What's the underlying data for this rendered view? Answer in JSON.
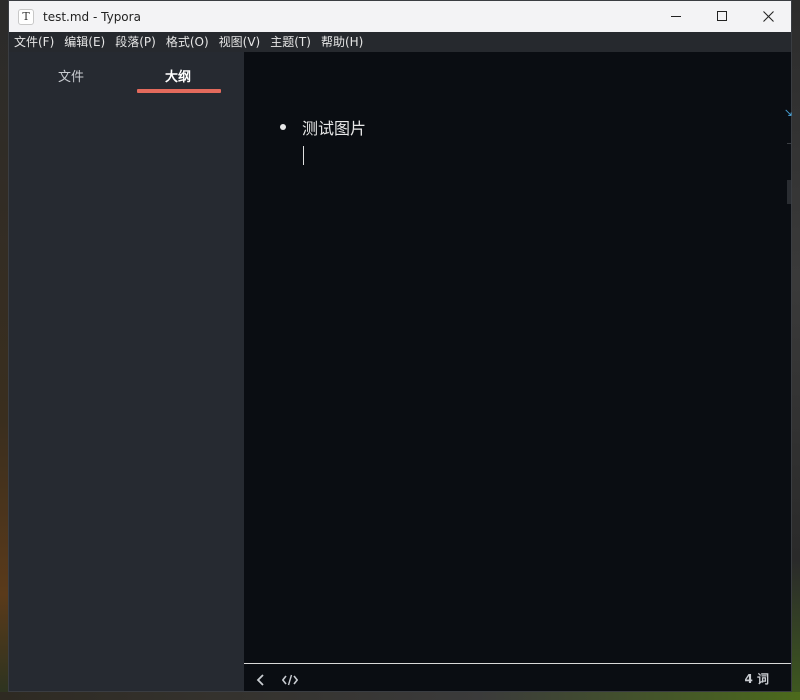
{
  "window": {
    "title": "test.md - Typora",
    "app_icon_letter": "T"
  },
  "menubar": {
    "items": [
      "文件(F)",
      "编辑(E)",
      "段落(P)",
      "格式(O)",
      "视图(V)",
      "主题(T)",
      "帮助(H)"
    ]
  },
  "sidebar": {
    "tabs": [
      {
        "label": "文件",
        "active": false
      },
      {
        "label": "大纲",
        "active": true
      }
    ],
    "accent_color": "#e36a5c"
  },
  "editor": {
    "list_items": [
      "测试图片"
    ]
  },
  "statusbar": {
    "word_count": "4 词"
  },
  "icons": {
    "minimize": "minimize-icon",
    "maximize": "maximize-icon",
    "close": "close-icon",
    "back": "chevron-left-icon",
    "source": "code-icon"
  }
}
